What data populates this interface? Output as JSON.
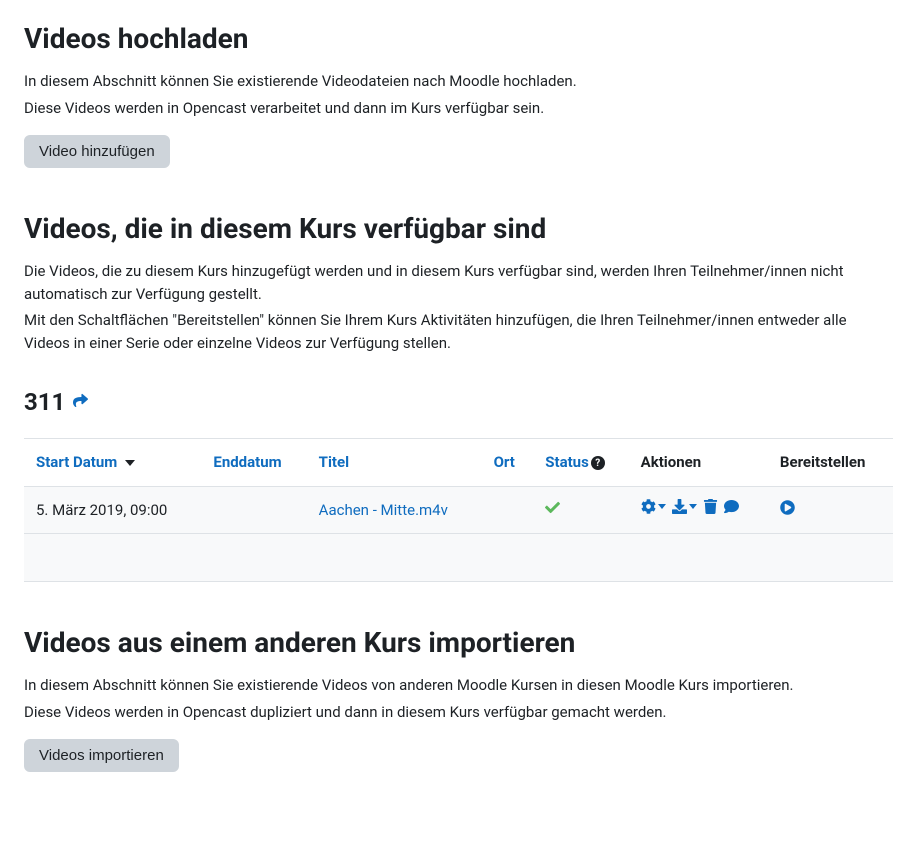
{
  "upload": {
    "heading": "Videos hochladen",
    "desc1": "In diesem Abschnitt können Sie existierende Videodateien nach Moodle hochladen.",
    "desc2": "Diese Videos werden in Opencast verarbeitet und dann im Kurs verfügbar sein.",
    "button": "Video hinzufügen"
  },
  "available": {
    "heading": "Videos, die in diesem Kurs verfügbar sind",
    "desc1": "Die Videos, die zu diesem Kurs hinzugefügt werden und in diesem Kurs verfügbar sind, werden Ihren Teilnehmer/innen nicht automatisch zur Verfügung gestellt.",
    "desc2": "Mit den Schaltflächen \"Bereitstellen\" können Sie Ihrem Kurs Aktivitäten hinzufügen, die Ihren Teilnehmer/innen entweder alle Videos in einer Serie oder einzelne Videos zur Verfügung stellen.",
    "course_name": "311",
    "columns": {
      "start_date": "Start Datum",
      "end_date": "Enddatum",
      "title": "Titel",
      "location": "Ort",
      "status": "Status",
      "actions": "Aktionen",
      "provide": "Bereitstellen"
    },
    "rows": [
      {
        "start_date": "5. März 2019, 09:00",
        "end_date": "",
        "title": "Aachen - Mitte.m4v",
        "location": "",
        "status": "ok"
      }
    ]
  },
  "import": {
    "heading": "Videos aus einem anderen Kurs importieren",
    "desc1": "In diesem Abschnitt können Sie existierende Videos von anderen Moodle Kursen in diesen Moodle Kurs importieren.",
    "desc2": "Diese Videos werden in Opencast dupliziert und dann in diesem Kurs verfügbar gemacht werden.",
    "button": "Videos importieren"
  }
}
